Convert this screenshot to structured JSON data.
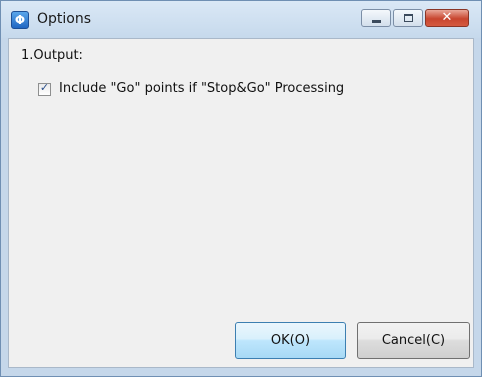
{
  "window": {
    "title": "Options",
    "app_icon_glyph": "Φ",
    "controls": {
      "minimize": "minimize",
      "maximize": "maximize",
      "close_glyph": "✕"
    }
  },
  "section": {
    "label": "1.Output:"
  },
  "option": {
    "checked": true,
    "check_glyph": "✓",
    "label": "Include \"Go\" points if \"Stop&Go\" Processing"
  },
  "buttons": {
    "ok_label": "OK(O)",
    "cancel_label": "Cancel(C)"
  },
  "colors": {
    "title_bar": "#c6d9ec",
    "client_background": "#f0f0f0",
    "default_button_border": "#3c7fb1",
    "close_button": "#c8452f"
  }
}
